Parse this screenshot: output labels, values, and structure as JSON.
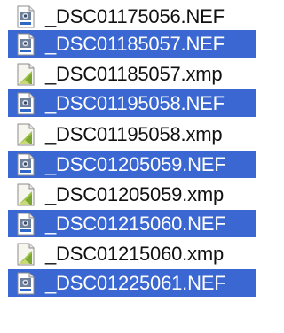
{
  "files": [
    {
      "name": "_DSC01175056.NEF",
      "type": "nef-icon",
      "selected": false
    },
    {
      "name": "_DSC01185057.NEF",
      "type": "nef-icon",
      "selected": true
    },
    {
      "name": "_DSC01185057.xmp",
      "type": "xmp-icon",
      "selected": false
    },
    {
      "name": "_DSC01195058.NEF",
      "type": "nef-icon",
      "selected": true
    },
    {
      "name": "_DSC01195058.xmp",
      "type": "xmp-icon",
      "selected": false
    },
    {
      "name": "_DSC01205059.NEF",
      "type": "nef-icon",
      "selected": true
    },
    {
      "name": "_DSC01205059.xmp",
      "type": "xmp-icon",
      "selected": false
    },
    {
      "name": "_DSC01215060.NEF",
      "type": "nef-icon",
      "selected": true
    },
    {
      "name": "_DSC01215060.xmp",
      "type": "xmp-icon",
      "selected": false
    },
    {
      "name": "_DSC01225061.NEF",
      "type": "nef-icon",
      "selected": true
    }
  ],
  "colors": {
    "selection": "#3a67d1",
    "text": "#111111",
    "selected_text": "#ffffff"
  }
}
